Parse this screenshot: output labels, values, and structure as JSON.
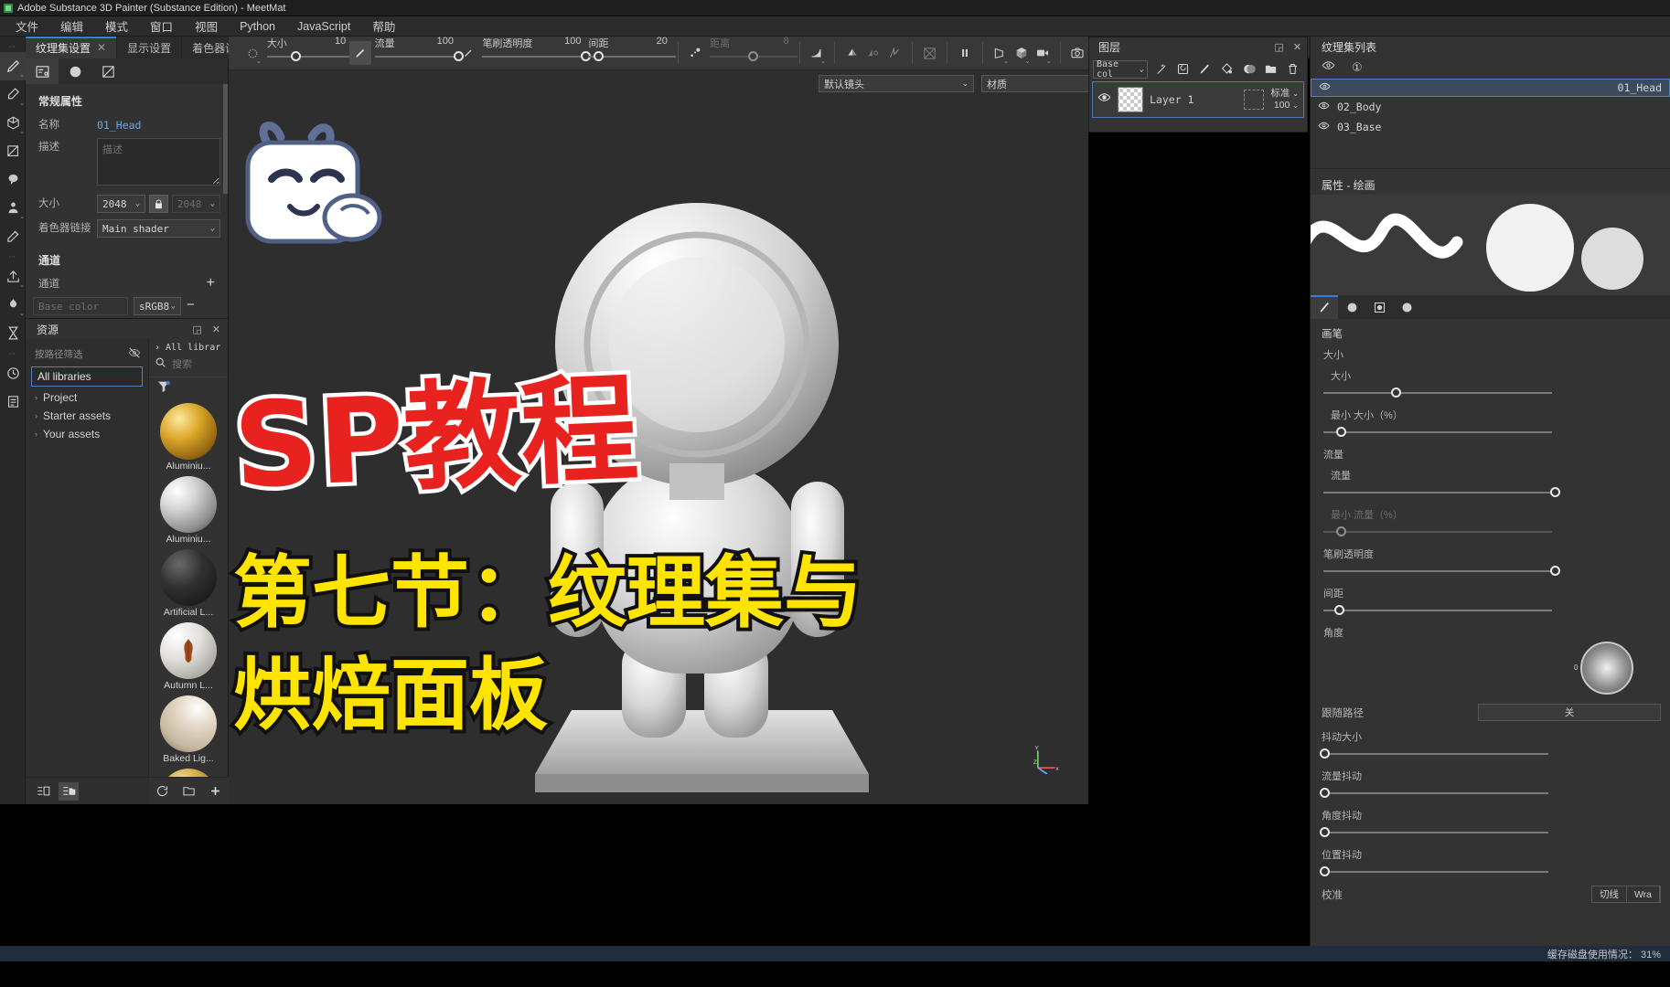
{
  "window": {
    "title": "Adobe Substance 3D Painter (Substance Edition) - MeetMat"
  },
  "menu": {
    "items": [
      "文件",
      "编辑",
      "模式",
      "窗口",
      "视图",
      "Python",
      "JavaScript",
      "帮助"
    ]
  },
  "left_tabs": [
    {
      "label": "纹理集设置",
      "close": "✕",
      "active": true
    },
    {
      "label": "显示设置",
      "active": false
    },
    {
      "label": "着色器设置",
      "active": false
    }
  ],
  "tool_rail": {
    "groups": [
      "⋯",
      "⋯",
      "⋯"
    ],
    "items": [
      {
        "name": "paint-tool",
        "glyph": "brush",
        "active": true,
        "chevron": "⌄"
      },
      {
        "name": "eraser-tool",
        "glyph": "eraser",
        "active": false,
        "chevron": "⌄"
      },
      {
        "name": "projection-tool",
        "glyph": "cube",
        "active": false,
        "chevron": "⌄"
      },
      {
        "name": "polygon-fill-tool",
        "glyph": "polyfill",
        "active": false,
        "chevron": ""
      },
      {
        "name": "smudge-tool",
        "glyph": "smudge",
        "active": false,
        "chevron": ""
      },
      {
        "name": "clone-tool",
        "glyph": "clone",
        "active": false,
        "chevron": "⌄"
      },
      {
        "name": "material-picker-tool",
        "glyph": "dropper",
        "active": false,
        "chevron": ""
      },
      {
        "name": "export-tool",
        "glyph": "export",
        "active": false,
        "chevron": "⌄"
      },
      {
        "name": "bake-tool",
        "glyph": "bake",
        "active": false,
        "chevron": "⌄"
      },
      {
        "name": "hourglass-tool",
        "glyph": "hourglass",
        "active": false,
        "chevron": ""
      },
      {
        "name": "history-tool",
        "glyph": "clock",
        "active": false,
        "chevron": ""
      },
      {
        "name": "log-tool",
        "glyph": "list",
        "active": false,
        "chevron": ""
      }
    ]
  },
  "texture_set_settings": {
    "subtabs": [
      {
        "name": "settings-subtab",
        "glyph": "sliders",
        "active": true
      },
      {
        "name": "shader-subtab",
        "glyph": "sphere",
        "active": false
      },
      {
        "name": "uv-subtab",
        "glyph": "uv",
        "active": false
      }
    ],
    "section_general": "常规属性",
    "name_label": "名称",
    "name_value": "01_Head",
    "desc_label": "描述",
    "desc_placeholder": "描述",
    "size_label": "大小",
    "size_width": "2048",
    "size_height": "2048",
    "lock_icon": "lock-icon",
    "shader_label": "着色器链接",
    "shader_value": "Main shader",
    "section_channels": "通道",
    "channels_label": "通道",
    "add_icon": "+",
    "remove_icon": "−",
    "channel_placeholder": "Base color",
    "channel_format": "sRGB8"
  },
  "resources": {
    "title": "资源",
    "maximize_icon": "◲",
    "close_icon": "✕",
    "filter_label": "按路径筛选",
    "eye_off_icon": "eye-off-icon",
    "library_selected": "All libraries",
    "tree": [
      {
        "arrow": "›",
        "label": "Project"
      },
      {
        "arrow": "›",
        "label": "Starter assets"
      },
      {
        "arrow": "›",
        "label": "Your assets"
      }
    ],
    "breadcrumb_arrow": "›",
    "breadcrumb": "All librar",
    "search_placeholder": "搜索",
    "assets": [
      {
        "label": "Aluminiu...",
        "color": "gold"
      },
      {
        "label": "Aluminiu...",
        "color": "silver"
      },
      {
        "label": "Artificial L...",
        "color": "black"
      },
      {
        "label": "Autumn L...",
        "color": "leaf"
      },
      {
        "label": "Baked Lig...",
        "color": "beige"
      },
      {
        "label": "",
        "color": "brass"
      }
    ],
    "footer_icons": [
      "list-view-icon",
      "grid-view-icon"
    ],
    "footer_right_icons": [
      "refresh-icon",
      "folder-icon",
      "add-icon"
    ]
  },
  "toolbar": {
    "alignment_icon": "alignment-icon",
    "sliders": [
      {
        "name": "size",
        "label": "大小",
        "value": "10",
        "pct": 30,
        "dim": false
      },
      {
        "name": "flow",
        "label": "流量",
        "value": "100",
        "pct": 96,
        "dim": false
      },
      {
        "name": "brush-opacity",
        "label": "笔刷透明度",
        "value": "100",
        "pct": 96,
        "dim": false
      },
      {
        "name": "spacing",
        "label": "间距",
        "value": "20",
        "pct": 12,
        "dim": false
      },
      {
        "name": "distance",
        "label": "距离",
        "value": "8",
        "pct": 45,
        "dim": true
      }
    ],
    "icons": [
      "brush-preview-icon",
      "brush-tip-icon",
      "falloff-icon",
      "symmetry-icon",
      "mirror-icon",
      "lazy-mouse-icon",
      "tiling-off-icon",
      "pause-icon",
      "perspective-icon",
      "cube-view-icon",
      "camera-bookmark-icon",
      "screenshot-icon"
    ]
  },
  "viewport": {
    "camera_select": "默认镜头",
    "material_select": "材质",
    "axis_x": "x",
    "axis_y": "Y",
    "axis_z": "Z"
  },
  "layers": {
    "title": "图层",
    "maximize_icon": "◲",
    "close_icon": "✕",
    "channel_select": "Base col",
    "tool_icons": [
      "magic-wand-icon",
      "smart-mask-icon",
      "paint-layer-icon",
      "fill-layer-icon",
      "adjustment-icon",
      "folder-icon",
      "trash-icon"
    ],
    "rows": [
      {
        "visible": true,
        "name": "Layer 1",
        "blend": "标准",
        "opacity": "100"
      }
    ]
  },
  "texture_set_list": {
    "title": "纹理集列表",
    "eye_icon": "eye-icon",
    "count_icon": "①",
    "items": [
      {
        "label": "01_Head",
        "selected": true
      },
      {
        "label": "02_Body",
        "selected": false
      },
      {
        "label": "03_Base",
        "selected": false
      }
    ]
  },
  "properties": {
    "title": "属性 - 绘画",
    "tabs": [
      {
        "name": "brush-tab",
        "glyph": "brush",
        "active": true
      },
      {
        "name": "alpha-tab",
        "glyph": "checker",
        "active": false
      },
      {
        "name": "stencil-tab",
        "glyph": "stencil",
        "active": false
      },
      {
        "name": "material-tab",
        "glyph": "sphere",
        "active": false
      }
    ],
    "group_brush": "画笔",
    "group_size": "大小",
    "size_label": "大小",
    "size_pct": 30,
    "min_size_label": "最小 大小（%）",
    "min_size_pct": 9,
    "group_flow": "流量",
    "flow_label": "流量",
    "flow_pct": 100,
    "min_flow_label": "最小 流量（%）",
    "min_flow_pct": 9,
    "group_opacity": "笔刷透明度",
    "opacity_pct": 100,
    "spacing_label": "间距",
    "spacing_pct": 8,
    "angle_label": "角度",
    "angle_value": "0",
    "follow_path_label": "跟随路径",
    "follow_path_value": "关",
    "jitter_size_label": "抖动大小",
    "jitter_size_pct": 0,
    "jitter_flow_label": "流量抖动",
    "jitter_flow_pct": 0,
    "jitter_angle_label": "角度抖动",
    "jitter_angle_pct": 0,
    "jitter_pos_label": "位置抖动",
    "jitter_pos_pct": 0,
    "align_label": "校准",
    "align_options": [
      "切线",
      "Wra"
    ]
  },
  "status": {
    "text": "缓存磁盘使用情况： 31%"
  },
  "overlay": {
    "title_main": "SP教程",
    "title_sub_1": "第七节：纹理集与",
    "title_sub_2": "烘焙面板"
  }
}
